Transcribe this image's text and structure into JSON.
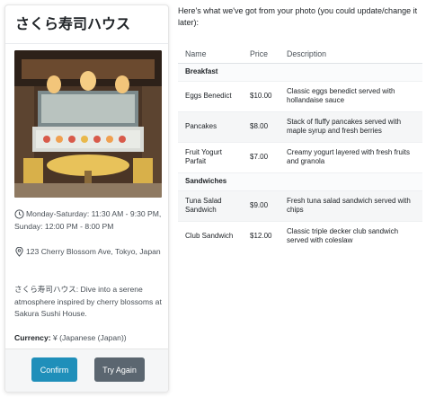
{
  "restaurant": {
    "name": "さくら寿司ハウス",
    "hours": "Monday-Saturday: 11:30 AM - 9:30 PM, Sunday: 12:00 PM - 8:00 PM",
    "address": "123 Cherry Blossom Ave, Tokyo, Japan",
    "description": "さくら寿司ハウス: Dive into a serene atmosphere inspired by cherry blossoms at Sakura Sushi House.",
    "currency_label": "Currency:",
    "currency_value": "¥ (Japanese (Japan))"
  },
  "actions": {
    "confirm": "Confirm",
    "try_again": "Try Again"
  },
  "intro": "Here's what we've got from your photo (you could update/change it later):",
  "menu_headers": {
    "name": "Name",
    "price": "Price",
    "description": "Description"
  },
  "categories": [
    {
      "name": "Breakfast",
      "items": [
        {
          "name": "Eggs Benedict",
          "price": "$10.00",
          "description": "Classic eggs benedict served with hollandaise sauce"
        },
        {
          "name": "Pancakes",
          "price": "$8.00",
          "description": "Stack of fluffy pancakes served with maple syrup and fresh berries"
        },
        {
          "name": "Fruit Yogurt Parfait",
          "price": "$7.00",
          "description": "Creamy yogurt layered with fresh fruits and granola"
        }
      ]
    },
    {
      "name": "Sandwiches",
      "items": [
        {
          "name": "Tuna Salad Sandwich",
          "price": "$9.00",
          "description": "Fresh tuna salad sandwich served with chips"
        },
        {
          "name": "Club Sandwich",
          "price": "$12.00",
          "description": "Classic triple decker club sandwich served with coleslaw"
        }
      ]
    }
  ],
  "icons": {
    "hours": "clock-icon",
    "address": "map-pin-icon"
  },
  "colors": {
    "confirm": "#1f8fba",
    "try_again": "#5b6670"
  }
}
